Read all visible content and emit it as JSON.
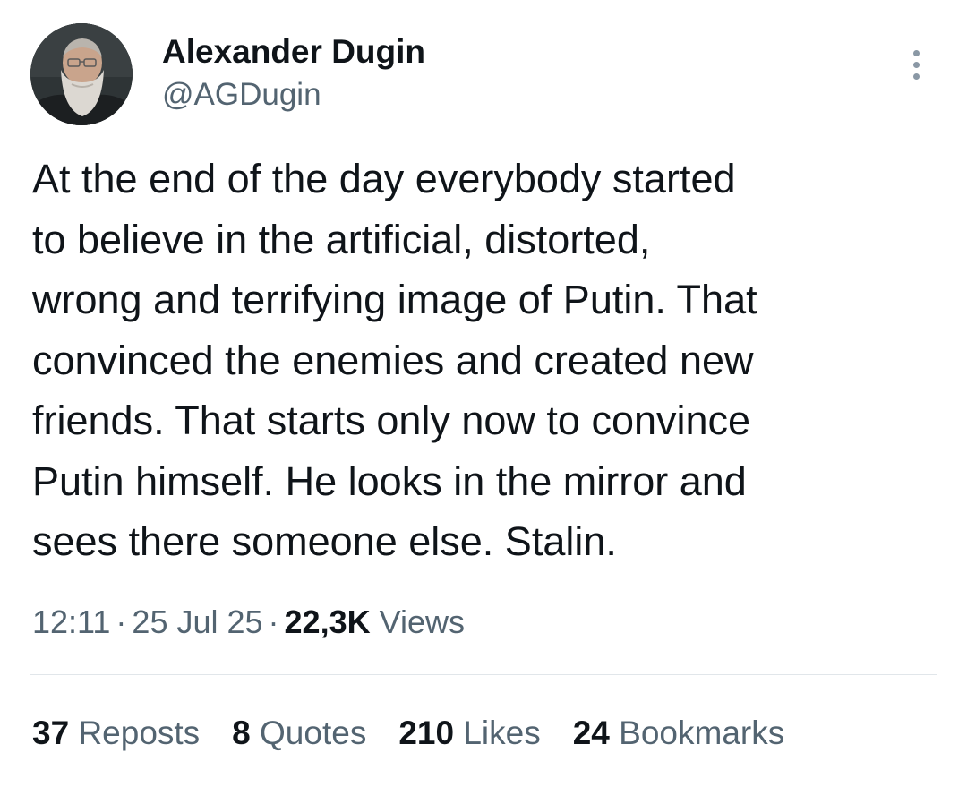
{
  "author": {
    "name": "Alexander Dugin",
    "handle": "@AGDugin"
  },
  "tweet": {
    "text": "At the end of the day everybody started\nto believe in the artificial, distorted,\nwrong and terrifying image of Putin. That\nconvinced the enemies and created new\nfriends. That starts only now to convince\nPutin himself. He looks in the mirror and\nsees there someone else. Stalin."
  },
  "meta": {
    "time": "12:11",
    "date": "25 Jul 25",
    "views_count": "22,3K",
    "views_label": "Views",
    "separator": "·"
  },
  "stats": [
    {
      "count": "37",
      "label": "Reposts"
    },
    {
      "count": "8",
      "label": "Quotes"
    },
    {
      "count": "210",
      "label": "Likes"
    },
    {
      "count": "24",
      "label": "Bookmarks"
    }
  ],
  "icons": {
    "more": "more-vertical-icon"
  },
  "colors": {
    "text_primary": "#0f1419",
    "text_secondary": "#536471",
    "divider": "#e1e6ea",
    "background": "#ffffff"
  }
}
